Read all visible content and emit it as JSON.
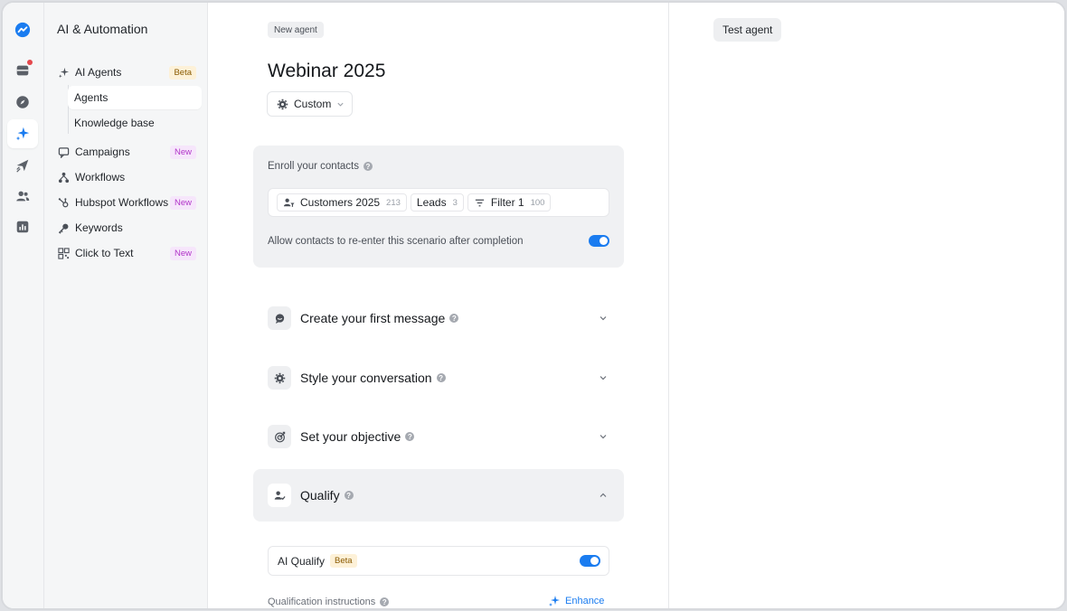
{
  "colors": {
    "accent": "#1a7cf0",
    "beta_bg": "#fdf1d8",
    "new_bg": "#f6e6fb",
    "new_text": "#b235c9",
    "notification": "#e5484d"
  },
  "rail": {
    "icons": [
      "logo-icon",
      "inbox-icon",
      "compass-icon",
      "ai-sparkle-icon",
      "send-icon",
      "contacts-icon",
      "analytics-icon"
    ]
  },
  "sidebar": {
    "title": "AI & Automation",
    "items": [
      {
        "label": "AI Agents",
        "badge": "Beta",
        "icon": "sparkle-icon"
      },
      {
        "label": "Agents",
        "sub": true,
        "active": true
      },
      {
        "label": "Knowledge base",
        "sub": true
      },
      {
        "label": "Campaigns",
        "badge": "New",
        "icon": "campaign-icon"
      },
      {
        "label": "Workflows",
        "icon": "workflow-icon"
      },
      {
        "label": "Hubspot Workflows",
        "badge": "New",
        "icon": "hubspot-icon"
      },
      {
        "label": "Keywords",
        "icon": "key-icon"
      },
      {
        "label": "Click to Text",
        "badge": "New",
        "icon": "qr-icon"
      }
    ]
  },
  "main": {
    "tag": "New agent",
    "title": "Webinar 2025",
    "mode_button": "Custom",
    "enroll": {
      "label": "Enroll your contacts",
      "chips": [
        {
          "label": "Customers 2025",
          "count": "213",
          "icon": "user-filter-icon"
        },
        {
          "label": "Leads",
          "count": "3"
        },
        {
          "label": "Filter 1",
          "count": "100",
          "icon": "filter-icon"
        }
      ],
      "reenter_label": "Allow contacts to re-enter this scenario after completion",
      "reenter_enabled": true
    },
    "sections": [
      {
        "title": "Create your first message",
        "icon": "message-icon",
        "expanded": false
      },
      {
        "title": "Style your conversation",
        "icon": "gear-icon",
        "expanded": false
      },
      {
        "title": "Set your objective",
        "icon": "target-icon",
        "expanded": false
      },
      {
        "title": "Qualify",
        "icon": "user-check-icon",
        "expanded": true
      }
    ],
    "qualify": {
      "ai_qualify_label": "AI Qualify",
      "ai_qualify_badge": "Beta",
      "ai_qualify_enabled": true,
      "instructions_label": "Qualification instructions",
      "enhance_label": "Enhance"
    }
  },
  "right": {
    "test_button": "Test agent"
  }
}
